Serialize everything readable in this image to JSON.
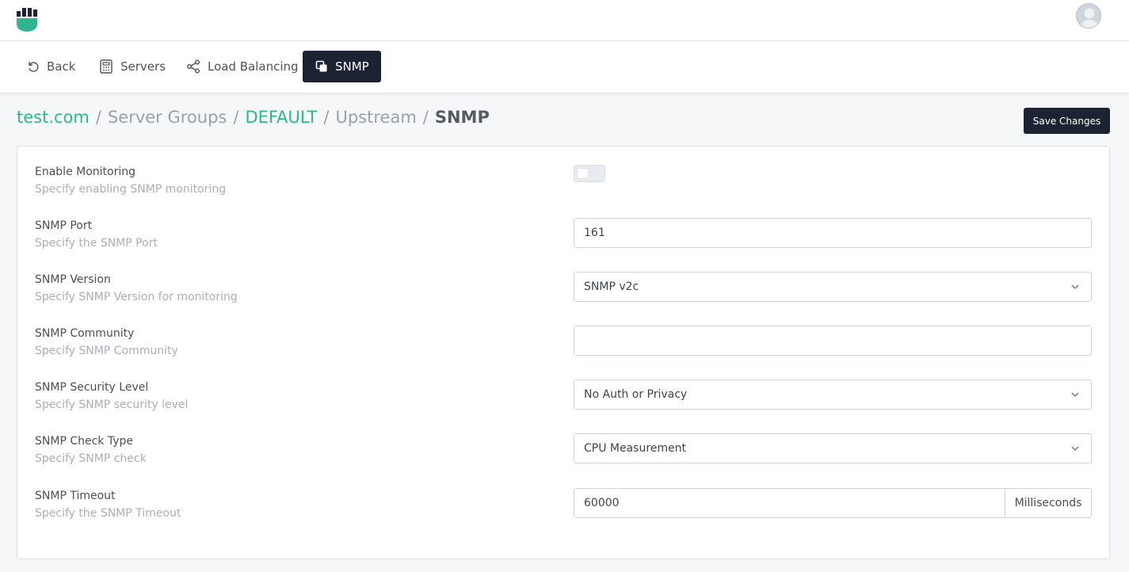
{
  "header": {
    "logo_icon": "shield-logo-icon",
    "brand_color": "#2fb590",
    "avatar_icon": "user-avatar-icon"
  },
  "nav": {
    "back_label": "Back",
    "servers_label": "Servers",
    "load_balancing_label": "Load Balancing",
    "snmp_label": "SNMP"
  },
  "breadcrumb": {
    "domain": "test.com",
    "server_groups": "Server Groups",
    "group": "DEFAULT",
    "upstream": "Upstream",
    "current": "SNMP",
    "separator": "/"
  },
  "actions": {
    "save_label": "Save Changes"
  },
  "form": {
    "enable_monitoring": {
      "label": "Enable Monitoring",
      "hint": "Specify enabling SNMP monitoring",
      "enabled": false
    },
    "port": {
      "label": "SNMP Port",
      "hint": "Specify the SNMP Port",
      "value": "161"
    },
    "version": {
      "label": "SNMP Version",
      "hint": "Specify SNMP Version for monitoring",
      "value": "SNMP v2c"
    },
    "community": {
      "label": "SNMP Community",
      "hint": "Specify SNMP Community",
      "value": ""
    },
    "security_level": {
      "label": "SNMP Security Level",
      "hint": "Specify SNMP security level",
      "value": "No Auth or Privacy"
    },
    "check_type": {
      "label": "SNMP Check Type",
      "hint": "Specify SNMP check",
      "value": "CPU Measurement"
    },
    "timeout": {
      "label": "SNMP Timeout",
      "hint": "Specify the SNMP Timeout",
      "value": "60000",
      "unit": "Milliseconds"
    }
  }
}
